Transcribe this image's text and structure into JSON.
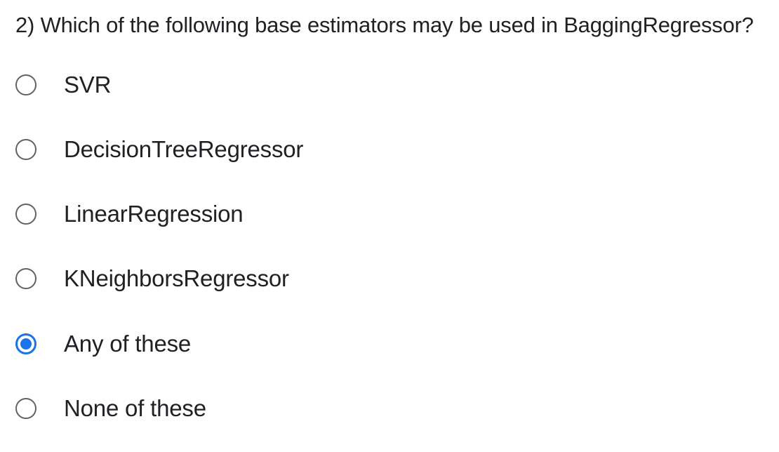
{
  "question": {
    "title": "2) Which of the following base estimators may be used in BaggingRegressor?"
  },
  "options": [
    {
      "label": "SVR",
      "selected": false
    },
    {
      "label": "DecisionTreeRegressor",
      "selected": false
    },
    {
      "label": "LinearRegression",
      "selected": false
    },
    {
      "label": "KNeighborsRegressor",
      "selected": false
    },
    {
      "label": "Any of these",
      "selected": true
    },
    {
      "label": "None of these",
      "selected": false
    }
  ],
  "colors": {
    "accent": "#1a73e8",
    "radio_border": "#5f6368",
    "text": "#202124"
  }
}
